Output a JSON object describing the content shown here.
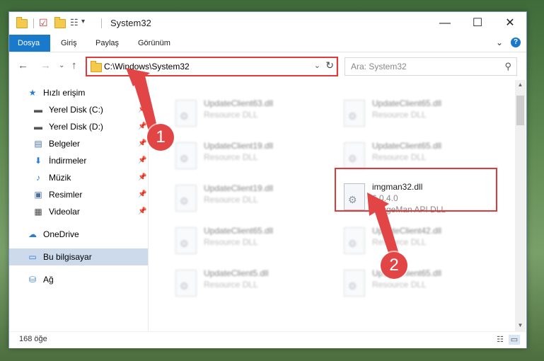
{
  "window": {
    "title": "System32",
    "minimize": "—",
    "maximize": "☐",
    "close": "✕"
  },
  "ribbon": {
    "tabs": [
      {
        "label": "Dosya",
        "active": true
      },
      {
        "label": "Giriş"
      },
      {
        "label": "Paylaş"
      },
      {
        "label": "Görünüm"
      }
    ],
    "expand": "⌄",
    "help": "?"
  },
  "nav": {
    "back": "←",
    "forward": "→",
    "recent": "⌄",
    "up": "↑",
    "address": "C:\\Windows\\System32",
    "address_dropdown": "⌄",
    "refresh": "↻",
    "search_placeholder": "Ara: System32",
    "search_icon": "⚲"
  },
  "sidebar": {
    "items": [
      {
        "label": "Hızlı erişim",
        "icon": "star-icon",
        "glyph": "★",
        "color": "#2b7cd3"
      },
      {
        "label": "Yerel Disk (C:)",
        "icon": "drive-icon",
        "glyph": "▬",
        "color": "#555555",
        "pinned": true
      },
      {
        "label": "Yerel Disk (D:)",
        "icon": "drive-icon",
        "glyph": "▬",
        "color": "#555555",
        "pinned": true
      },
      {
        "label": "Belgeler",
        "icon": "documents-icon",
        "glyph": "▤",
        "color": "#4a6fa5",
        "pinned": true
      },
      {
        "label": "İndirmeler",
        "icon": "download-icon",
        "glyph": "⬇",
        "color": "#2b7cd3",
        "pinned": true
      },
      {
        "label": "Müzik",
        "icon": "music-icon",
        "glyph": "♪",
        "color": "#2b7cd3",
        "pinned": true
      },
      {
        "label": "Resimler",
        "icon": "pictures-icon",
        "glyph": "▣",
        "color": "#4a6fa5",
        "pinned": true
      },
      {
        "label": "Videolar",
        "icon": "videos-icon",
        "glyph": "▦",
        "color": "#444444",
        "pinned": true
      },
      {
        "label": "OneDrive",
        "icon": "cloud-icon",
        "glyph": "☁",
        "color": "#2b7cd3"
      },
      {
        "label": "Bu bilgisayar",
        "icon": "computer-icon",
        "glyph": "▭",
        "color": "#2b7cd3",
        "selected": true
      },
      {
        "label": "Ağ",
        "icon": "network-icon",
        "glyph": "⛁",
        "color": "#2b7cd3"
      }
    ],
    "pin_glyph": "📌"
  },
  "files": {
    "blurred": [
      {
        "name": "UpdateClient63.dll",
        "type": "Resource DLL"
      },
      {
        "name": "UpdateClient65.dll",
        "type": "Resource DLL"
      },
      {
        "name": "UpdateClient19.dll",
        "type": "Resource DLL"
      },
      {
        "name": "UpdateClient65.dll",
        "type": "Resource DLL"
      },
      {
        "name": "UpdateClient19.dll",
        "type": "Resource DLL"
      },
      {
        "name": "UpdateClient65.dll",
        "type": "Resource DLL"
      },
      {
        "name": "UpdateClient42.dll",
        "type": "Resource DLL"
      },
      {
        "name": "UpdateClient5.dll",
        "type": "Resource DLL"
      },
      {
        "name": "UpdateClient65.dll",
        "type": "Resource DLL"
      }
    ],
    "highlighted": {
      "name": "imgman32.dll",
      "version": "6.0.4.0",
      "type": "ImageMan API DLL"
    }
  },
  "status": {
    "count": "168 öğe"
  },
  "annotations": {
    "step1": "1",
    "step2": "2",
    "color": "#e24545"
  }
}
